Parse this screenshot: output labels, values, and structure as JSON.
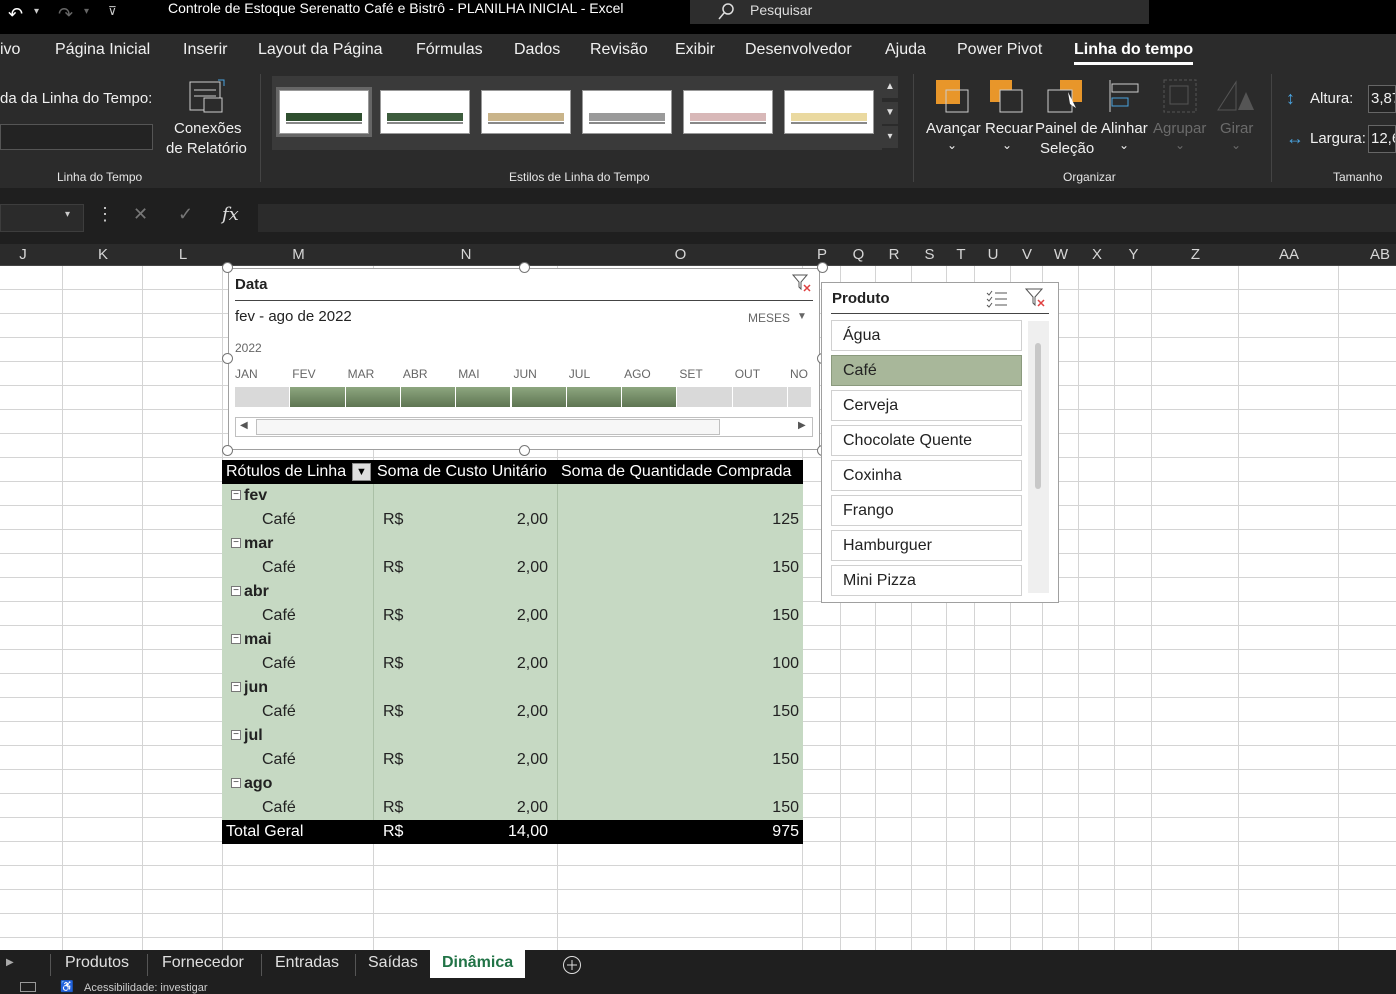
{
  "title": "Controle de Estoque Serenatto Café e Bistrô - PLANILHA INICIAL  -  Excel",
  "search_placeholder": "Pesquisar",
  "tabs": [
    "ivo",
    "Página Inicial",
    "Inserir",
    "Layout da Página",
    "Fórmulas",
    "Dados",
    "Revisão",
    "Exibir",
    "Desenvolvedor",
    "Ajuda",
    "Power Pivot",
    "Linha do tempo"
  ],
  "ribbon": {
    "caption_label": "da da Linha do Tempo:",
    "report_connections_line1": "Conexões",
    "report_connections_line2": "de Relatório",
    "group_timeline": "Linha do Tempo",
    "group_styles": "Estilos de Linha do Tempo",
    "group_arrange": "Organizar",
    "group_size": "Tamanho",
    "forward": "Avançar",
    "backward": "Recuar",
    "selection_pane_line1": "Painel de",
    "selection_pane_line2": "Seleção",
    "align": "Alinhar",
    "group": "Agrupar",
    "rotate": "Girar",
    "height_label": "Altura:",
    "height_value": "3,87",
    "width_label": "Largura:",
    "width_value": "12,6"
  },
  "formula_bar": {
    "fx": "fx"
  },
  "columns": [
    "J",
    "K",
    "L",
    "M",
    "N",
    "O",
    "P",
    "Q",
    "R",
    "S",
    "T",
    "U",
    "V",
    "W",
    "X",
    "Y",
    "Z",
    "AA",
    "AB"
  ],
  "timeline": {
    "header": "Data",
    "range_label": "fev - ago de 2022",
    "level": "MESES",
    "year": "2022",
    "months": [
      "JAN",
      "FEV",
      "MAR",
      "ABR",
      "MAI",
      "JUN",
      "JUL",
      "AGO",
      "SET",
      "OUT",
      "NO"
    ],
    "selected_start": 1,
    "selected_end": 7,
    "selected_color": "#5e7552"
  },
  "pivot": {
    "headers": [
      "Rótulos de Linha",
      "Soma de Custo Unitário",
      "Soma de Quantidade Comprada"
    ],
    "rows": [
      {
        "month": "fev",
        "item": "Café",
        "currency": "R$",
        "cost": "2,00",
        "qty": "125"
      },
      {
        "month": "mar",
        "item": "Café",
        "currency": "R$",
        "cost": "2,00",
        "qty": "150"
      },
      {
        "month": "abr",
        "item": "Café",
        "currency": "R$",
        "cost": "2,00",
        "qty": "150"
      },
      {
        "month": "mai",
        "item": "Café",
        "currency": "R$",
        "cost": "2,00",
        "qty": "100"
      },
      {
        "month": "jun",
        "item": "Café",
        "currency": "R$",
        "cost": "2,00",
        "qty": "150"
      },
      {
        "month": "jul",
        "item": "Café",
        "currency": "R$",
        "cost": "2,00",
        "qty": "150"
      },
      {
        "month": "ago",
        "item": "Café",
        "currency": "R$",
        "cost": "2,00",
        "qty": "150"
      }
    ],
    "total": {
      "label": "Total Geral",
      "currency": "R$",
      "cost": "14,00",
      "qty": "975"
    }
  },
  "slicer": {
    "header": "Produto",
    "items": [
      "Água",
      "Café",
      "Cerveja",
      "Chocolate Quente",
      "Coxinha",
      "Frango",
      "Hamburguer",
      "Mini Pizza"
    ],
    "selected": "Café"
  },
  "sheets": [
    "Produtos",
    "Fornecedor",
    "Entradas",
    "Saídas",
    "Dinâmica"
  ],
  "active_sheet": "Dinâmica",
  "status": "Acessibilidade: investigar"
}
